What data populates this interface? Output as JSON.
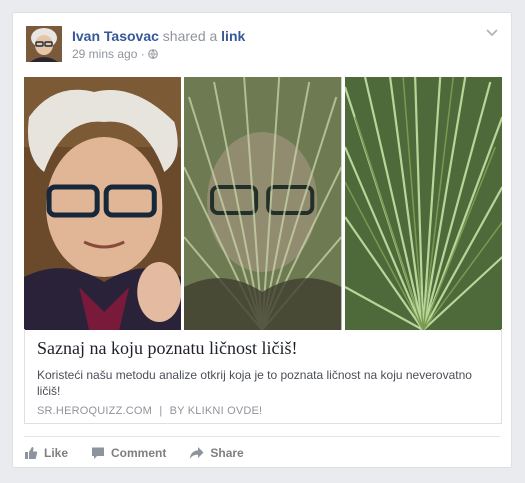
{
  "post": {
    "author": "Ivan Tasovac",
    "action_text": "shared a",
    "action_link": "link",
    "time": "29 mins ago",
    "separator": "·"
  },
  "link_preview": {
    "title": "Saznaj na koju poznatu ličnost ličiš!",
    "description": "Koristeći našu metodu analize otkrij koja je to poznata ličnost na koju neverovatno ličiš!",
    "source": "SR.HEROQUIZZ.COM",
    "source_separator": "|",
    "cta": "BY KLIKNI OVDE!"
  },
  "actions": {
    "like": "Like",
    "comment": "Comment",
    "share": "Share"
  },
  "icons": {
    "privacy": "globe-icon",
    "menu": "chevron-down-icon",
    "like": "thumbs-up-icon",
    "comment": "comment-icon",
    "share": "share-arrow-icon"
  },
  "colors": {
    "link_blue": "#365899",
    "meta_gray": "#90949c",
    "background": "#e9ebee"
  }
}
